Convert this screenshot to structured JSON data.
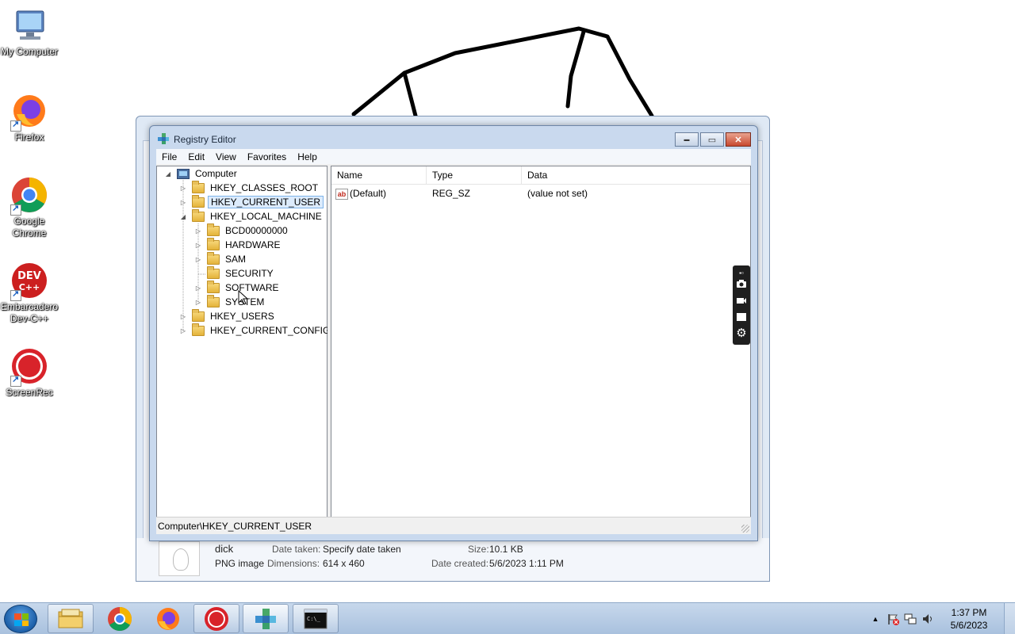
{
  "desktop": {
    "icons": [
      {
        "label": "My Computer"
      },
      {
        "label": "Firefox"
      },
      {
        "label": "Google Chrome"
      },
      {
        "label": "Embarcadero Dev-C++"
      },
      {
        "label": "ScreenRec"
      }
    ]
  },
  "bg_window": {
    "file_name": "dick",
    "file_type": "PNG image",
    "date_taken_label": "Date taken:",
    "date_taken_value": "Specify date taken",
    "dimensions_label": "Dimensions:",
    "dimensions_value": "614 x 460",
    "size_label": "Size:",
    "size_value": "10.1 KB",
    "date_created_label": "Date created:",
    "date_created_value": "5/6/2023 1:11 PM"
  },
  "regedit": {
    "title": "Registry Editor",
    "controls": {
      "minimize": "▬",
      "maximize": "▭",
      "close": "✕"
    },
    "menu": [
      "File",
      "Edit",
      "View",
      "Favorites",
      "Help"
    ],
    "tree": {
      "root": "Computer",
      "hives": [
        {
          "label": "HKEY_CLASSES_ROOT"
        },
        {
          "label": "HKEY_CURRENT_USER"
        },
        {
          "label": "HKEY_LOCAL_MACHINE"
        },
        {
          "label": "BCD00000000"
        },
        {
          "label": "HARDWARE"
        },
        {
          "label": "SAM"
        },
        {
          "label": "SECURITY"
        },
        {
          "label": "SOFTWARE"
        },
        {
          "label": "SYSTEM"
        },
        {
          "label": "HKEY_USERS"
        },
        {
          "label": "HKEY_CURRENT_CONFIG"
        }
      ],
      "selected": "HKEY_CURRENT_USER"
    },
    "columns": [
      "Name",
      "Type",
      "Data"
    ],
    "values": [
      {
        "icon": "ab",
        "name": "(Default)",
        "type": "REG_SZ",
        "data": "(value not set)"
      }
    ],
    "status": "Computer\\HKEY_CURRENT_USER"
  },
  "recorder_toolbar": {
    "icons": [
      "camera-icon",
      "video-icon",
      "screen-icon",
      "settings-icon"
    ]
  },
  "taskbar": {
    "items": [
      "file-explorer",
      "google-chrome",
      "firefox",
      "screenrec",
      "registry-editor",
      "command-prompt"
    ],
    "time": "1:37 PM",
    "date": "5/6/2023",
    "colors": {
      "bar": "#b8cde6",
      "accent": "#1d5fa8"
    }
  }
}
